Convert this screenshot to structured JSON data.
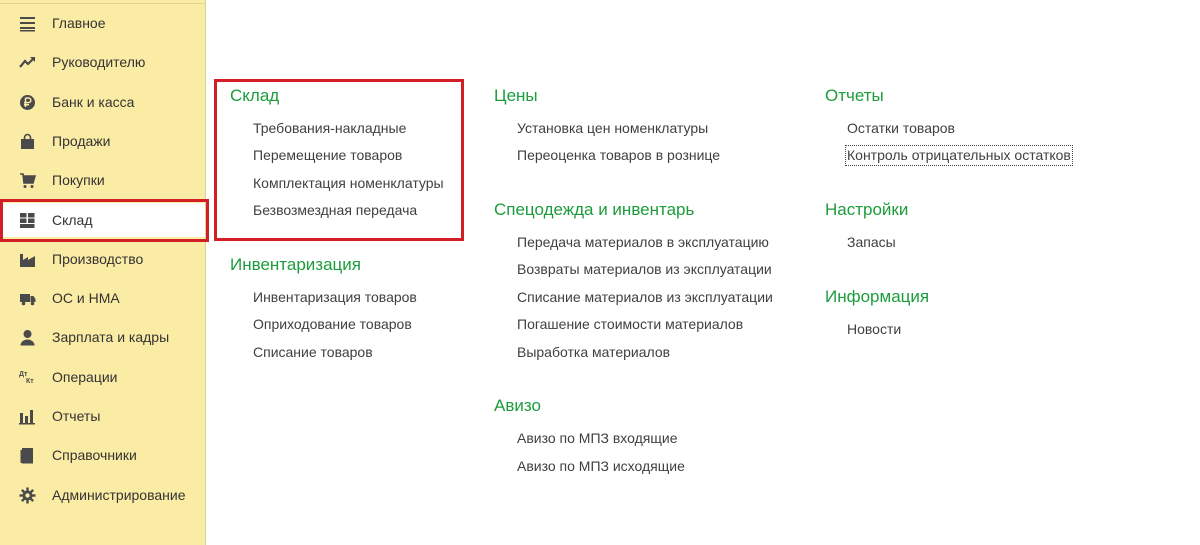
{
  "sidebar": {
    "items": [
      {
        "label": "Главное",
        "icon": "menu-icon"
      },
      {
        "label": "Руководителю",
        "icon": "trend-icon"
      },
      {
        "label": "Банк и касса",
        "icon": "ruble-icon"
      },
      {
        "label": "Продажи",
        "icon": "shopping-bag-icon"
      },
      {
        "label": "Покупки",
        "icon": "cart-icon"
      },
      {
        "label": "Склад",
        "icon": "warehouse-icon",
        "active": true
      },
      {
        "label": "Производство",
        "icon": "factory-icon"
      },
      {
        "label": "ОС и НМА",
        "icon": "truck-icon"
      },
      {
        "label": "Зарплата и кадры",
        "icon": "person-icon"
      },
      {
        "label": "Операции",
        "icon": "debit-credit-icon",
        "icon_text": {
          "dt": "Дт",
          "kt": "Кт"
        }
      },
      {
        "label": "Отчеты",
        "icon": "bar-chart-icon"
      },
      {
        "label": "Справочники",
        "icon": "book-icon"
      },
      {
        "label": "Администрирование",
        "icon": "gear-icon"
      }
    ]
  },
  "content": {
    "sections": {
      "sklad": {
        "title": "Склад",
        "links": [
          "Требования-накладные",
          "Перемещение товаров",
          "Комплектация номенклатуры",
          "Безвозмездная передача"
        ]
      },
      "inventarizaciya": {
        "title": "Инвентаризация",
        "links": [
          "Инвентаризация товаров",
          "Оприходование товаров",
          "Списание товаров"
        ]
      },
      "ceny": {
        "title": "Цены",
        "links": [
          "Установка цен номенклатуры",
          "Переоценка товаров в рознице"
        ]
      },
      "specodezhda": {
        "title": "Спецодежда и инвентарь",
        "links": [
          "Передача материалов в эксплуатацию",
          "Возвраты материалов из эксплуатации",
          "Списание материалов из эксплуатации",
          "Погашение стоимости материалов",
          "Выработка материалов"
        ]
      },
      "avizo": {
        "title": "Авизо",
        "links": [
          "Авизо по МПЗ входящие",
          "Авизо по МПЗ исходящие"
        ]
      },
      "otchety": {
        "title": "Отчеты",
        "links": [
          "Остатки товаров",
          "Контроль отрицательных остатков"
        ]
      },
      "nastroyki": {
        "title": "Настройки",
        "links": [
          "Запасы"
        ]
      },
      "informaciya": {
        "title": "Информация",
        "links": [
          "Новости"
        ]
      }
    }
  },
  "colors": {
    "sidebar_bg": "#fbeca5",
    "section_title": "#1c9c3c",
    "highlight": "#d21f26",
    "icon": "#4a4a4a"
  }
}
